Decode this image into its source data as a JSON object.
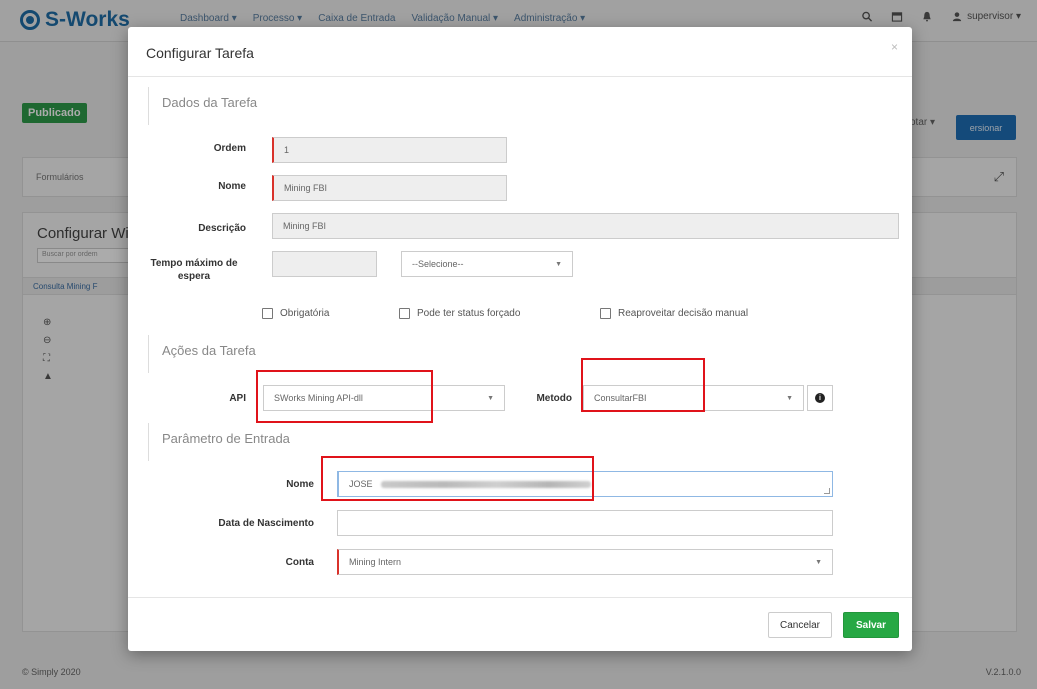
{
  "app": {
    "logo": "S-Works",
    "nav": [
      "Dashboard ▾",
      "Processo ▾",
      "Caixa de Entrada",
      "Validação Manual ▾",
      "Administração ▾"
    ],
    "user": "supervisor ▾"
  },
  "background": {
    "status_badge": "Publicado",
    "action_light": "otar ▾",
    "action_primary": "ersionar",
    "panel_label": "Formulários",
    "panel_title": "Configurar Wi",
    "search_placeholder": "Buscar por ordem",
    "row_label": "Consulta Mining F",
    "footer_left": "© Simply 2020",
    "footer_right": "V.2.1.0.0"
  },
  "modal": {
    "title": "Configurar Tarefa",
    "close": "×",
    "sections": {
      "dados": "Dados da Tarefa",
      "acoes": "Ações da Tarefa",
      "parametro": "Parâmetro de Entrada"
    },
    "fields": {
      "ordem": {
        "label": "Ordem",
        "value": "1"
      },
      "nome": {
        "label": "Nome",
        "value": "Mining FBI"
      },
      "descricao": {
        "label": "Descrição",
        "value": "Mining FBI"
      },
      "tempo": {
        "label_line1": "Tempo máximo de",
        "label_line2": "espera",
        "value": "",
        "unit": "--Selecione--"
      }
    },
    "checkboxes": {
      "obrigatoria": "Obrigatória",
      "status_forcado": "Pode ter status forçado",
      "reaproveitar": "Reaproveitar decisão manual"
    },
    "acoes": {
      "api_label": "API",
      "api_value": "SWorks Mining API-dll",
      "metodo_label": "Metodo",
      "metodo_value": "ConsultarFBI"
    },
    "parametros": {
      "nome_label": "Nome",
      "nome_value": "JOSE",
      "nascimento_label": "Data de Nascimento",
      "nascimento_value": "",
      "conta_label": "Conta",
      "conta_value": "Mining Intern"
    },
    "buttons": {
      "cancel": "Cancelar",
      "save": "Salvar"
    }
  },
  "colors": {
    "highlight": "#e0131a",
    "primary": "#1e6fb7",
    "success": "#27a844",
    "required": "#d9322b"
  }
}
